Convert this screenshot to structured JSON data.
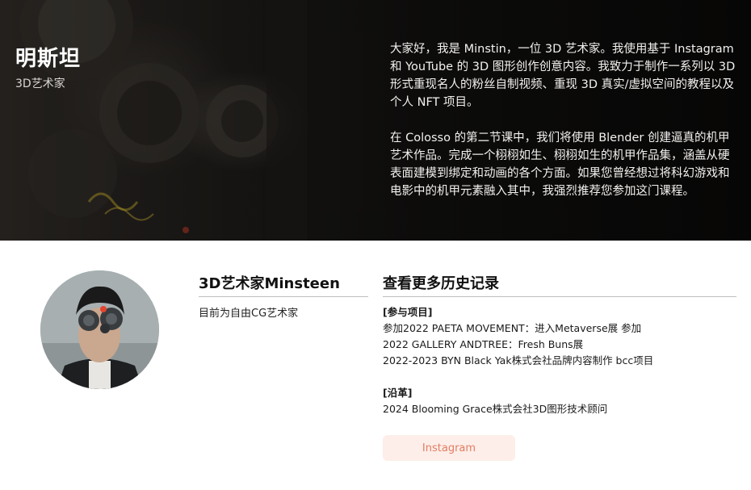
{
  "hero": {
    "name": "明斯坦",
    "role": "3D艺术家",
    "paragraphs": [
      "大家好，我是 Minstin，一位 3D 艺术家。我使用基于 Instagram 和 YouTube 的 3D 图形创作创意内容。我致力于制作一系列以 3D 形式重现名人的粉丝自制视频、重现 3D 真实/虚拟空间的教程以及个人 NFT 项目。",
      "在 Colosso 的第二节课中，我们将使用 Blender 创建逼真的机甲艺术作品。完成一个栩栩如生、栩栩如生的机甲作品集，涵盖从硬表面建模到绑定和动画的各个方面。如果您曾经想过将科幻游戏和电影中的机甲元素融入其中，我强烈推荐您参加这门课程。"
    ]
  },
  "profile": {
    "title": "3D艺术家Minsteen",
    "status": "目前为自由CG艺术家"
  },
  "history": {
    "title": "查看更多历史记录",
    "projects_head": "[参与项目]",
    "projects": [
      "参加2022 PAETA MOVEMENT：进入Metaverse展 参加",
      "2022 GALLERY ANDTREE：Fresh Buns展",
      "2022-2023 BYN Black Yak株式会社品牌内容制作 bcc项目"
    ],
    "career_head": "[沿革]",
    "career": [
      "2024 Blooming Grace株式会社3D图形技术顾问"
    ]
  },
  "button": {
    "instagram_label": "Instagram"
  },
  "colors": {
    "button_bg": "#fdeee9",
    "button_text": "#e27d63",
    "hero_bg": "#141311"
  }
}
